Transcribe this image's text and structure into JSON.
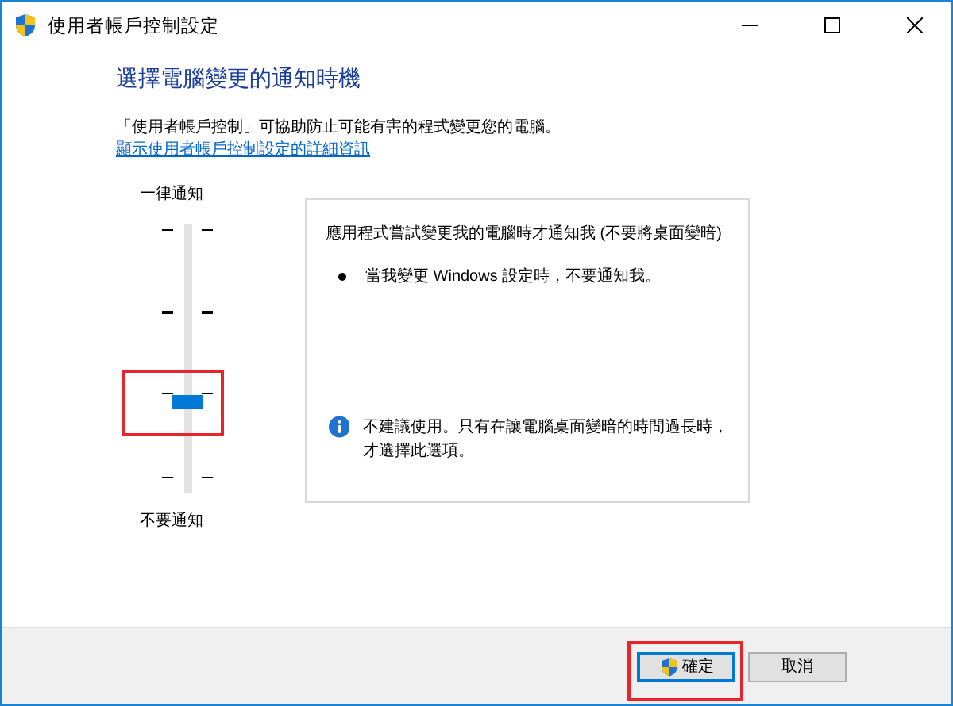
{
  "window": {
    "title": "使用者帳戶控制設定"
  },
  "heading": "選擇電腦變更的通知時機",
  "description": "「使用者帳戶控制」可協助防止可能有害的程式變更您的電腦。",
  "details_link": "顯示使用者帳戶控制設定的詳細資訊",
  "slider": {
    "top_label": "一律通知",
    "bottom_label": "不要通知",
    "level": 0.333,
    "highlighted": true
  },
  "info_panel": {
    "title": "應用程式嘗試變更我的電腦時才通知我 (不要將桌面變暗)",
    "bullets": [
      "當我變更 Windows 設定時，不要通知我。"
    ],
    "note": "不建議使用。只有在讓電腦桌面變暗的時間過長時，才選擇此選項。"
  },
  "buttons": [
    {
      "label": "確定",
      "default": true,
      "shield": true,
      "highlighted": true
    },
    {
      "label": "取消",
      "default": false,
      "shield": false,
      "highlighted": false
    }
  ]
}
